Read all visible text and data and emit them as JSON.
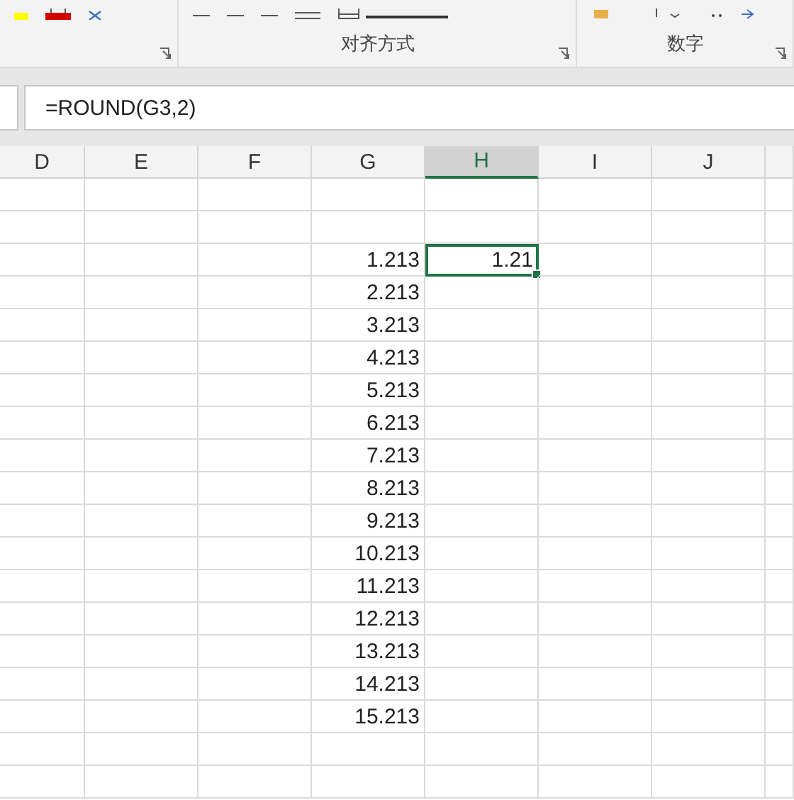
{
  "ribbon": {
    "groups": [
      {
        "kind": "font"
      },
      {
        "kind": "alignment",
        "label": "对齐方式"
      },
      {
        "kind": "number",
        "label": "数字"
      }
    ]
  },
  "formula_bar": {
    "value": "=ROUND(G3,2)"
  },
  "columns": [
    {
      "label": "D",
      "selected": false
    },
    {
      "label": "E",
      "selected": false
    },
    {
      "label": "F",
      "selected": false
    },
    {
      "label": "G",
      "selected": false
    },
    {
      "label": "H",
      "selected": true
    },
    {
      "label": "I",
      "selected": false
    },
    {
      "label": "J",
      "selected": false
    },
    {
      "selected": false
    }
  ],
  "rows": [
    {},
    {},
    {
      "column_g": {
        "text": "1.213",
        "selected": false
      },
      "column_h": {
        "text": "1.21",
        "selected": true
      }
    },
    {
      "column_g": {
        "text": "2.213",
        "selected": false
      }
    },
    {
      "column_g": {
        "text": "3.213",
        "selected": false
      }
    },
    {
      "column_g": {
        "text": "4.213",
        "selected": false
      }
    },
    {
      "column_g": {
        "text": "5.213",
        "selected": false
      }
    },
    {
      "column_g": {
        "text": "6.213",
        "selected": false
      }
    },
    {
      "column_g": {
        "text": "7.213",
        "selected": false
      }
    },
    {
      "column_g": {
        "text": "8.213",
        "selected": false
      }
    },
    {
      "column_g": {
        "text": "9.213",
        "selected": false
      }
    },
    {
      "column_g": {
        "text": "10.213",
        "selected": false
      }
    },
    {
      "column_g": {
        "text": "11.213",
        "selected": false
      }
    },
    {
      "column_g": {
        "text": "12.213",
        "selected": false
      }
    },
    {
      "column_g": {
        "text": "13.213",
        "selected": false
      }
    },
    {
      "column_g": {
        "text": "14.213",
        "selected": false
      }
    },
    {
      "column_g": {
        "text": "15.213",
        "selected": false
      }
    },
    {},
    {}
  ]
}
